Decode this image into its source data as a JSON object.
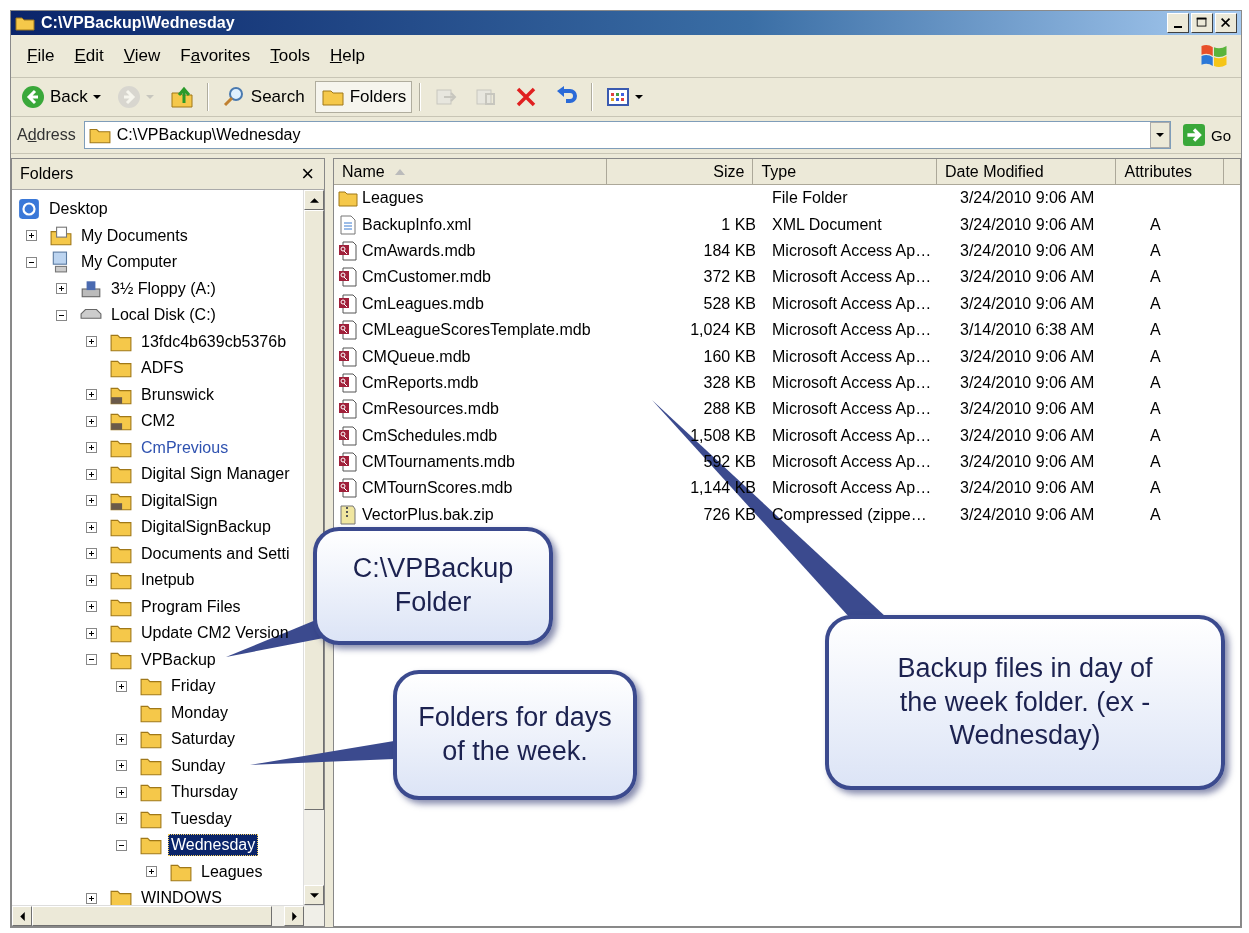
{
  "window": {
    "title": "C:\\VPBackup\\Wednesday"
  },
  "menu": [
    {
      "label": "File"
    },
    {
      "label": "Edit"
    },
    {
      "label": "View"
    },
    {
      "label": "Favorites"
    },
    {
      "label": "Tools"
    },
    {
      "label": "Help"
    }
  ],
  "toolbar": [
    {
      "kind": "back",
      "label": "Back",
      "disabled": false,
      "pressed": false,
      "dropdown": true
    },
    {
      "kind": "forward",
      "disabled": true,
      "pressed": false,
      "dropdown": true
    },
    {
      "kind": "up",
      "disabled": false,
      "pressed": false,
      "dropdown": false
    },
    {
      "kind": "separator"
    },
    {
      "kind": "search",
      "label": "Search",
      "disabled": false,
      "pressed": false,
      "dropdown": false
    },
    {
      "kind": "folders",
      "label": "Folders",
      "disabled": false,
      "pressed": true,
      "dropdown": false
    },
    {
      "kind": "separator"
    },
    {
      "kind": "move",
      "disabled": true,
      "pressed": false,
      "dropdown": false
    },
    {
      "kind": "copy",
      "disabled": true,
      "pressed": false,
      "dropdown": false
    },
    {
      "kind": "delete",
      "disabled": false,
      "pressed": false,
      "dropdown": false
    },
    {
      "kind": "undo",
      "disabled": false,
      "pressed": false,
      "dropdown": false
    },
    {
      "kind": "separator"
    },
    {
      "kind": "views",
      "disabled": false,
      "pressed": false,
      "dropdown": true
    }
  ],
  "address": {
    "label": "Address",
    "value": "C:\\VPBackup\\Wednesday",
    "go": "Go"
  },
  "folders_pane": {
    "title": "Folders",
    "close": "×"
  },
  "tree": [
    {
      "label": "Desktop",
      "kind": "desktop",
      "selected": false,
      "compressed": false,
      "children": [
        {
          "label": "My Documents",
          "kind": "documents",
          "expandable": true,
          "expanded": false,
          "selected": false,
          "compressed": false
        },
        {
          "label": "My Computer",
          "kind": "computer",
          "expandable": true,
          "expanded": true,
          "selected": false,
          "compressed": false,
          "children": [
            {
              "label": "3½ Floppy (A:)",
              "kind": "floppy",
              "expandable": true,
              "expanded": false,
              "selected": false,
              "compressed": false
            },
            {
              "label": "Local Disk (C:)",
              "kind": "drive",
              "expandable": true,
              "expanded": true,
              "selected": false,
              "compressed": false,
              "children": [
                {
                  "label": "13fdc4b639cb5376b",
                  "kind": "folder",
                  "expandable": true,
                  "expanded": false,
                  "selected": false,
                  "compressed": false
                },
                {
                  "label": "ADFS",
                  "kind": "folder",
                  "expandable": false,
                  "expanded": false,
                  "selected": false,
                  "compressed": false
                },
                {
                  "label": "Brunswick",
                  "kind": "shared-folder",
                  "expandable": true,
                  "expanded": false,
                  "selected": false,
                  "compressed": false
                },
                {
                  "label": "CM2",
                  "kind": "shared-folder",
                  "expandable": true,
                  "expanded": false,
                  "selected": false,
                  "compressed": false
                },
                {
                  "label": "CmPrevious",
                  "kind": "folder",
                  "expandable": true,
                  "expanded": false,
                  "selected": false,
                  "compressed": true
                },
                {
                  "label": "Digital Sign Manager",
                  "kind": "folder",
                  "expandable": true,
                  "expanded": false,
                  "selected": false,
                  "compressed": false
                },
                {
                  "label": "DigitalSign",
                  "kind": "shared-folder",
                  "expandable": true,
                  "expanded": false,
                  "selected": false,
                  "compressed": false
                },
                {
                  "label": "DigitalSignBackup",
                  "kind": "folder",
                  "expandable": true,
                  "expanded": false,
                  "selected": false,
                  "compressed": false
                },
                {
                  "label": "Documents and Setti",
                  "kind": "folder",
                  "expandable": true,
                  "expanded": false,
                  "selected": false,
                  "compressed": false
                },
                {
                  "label": "Inetpub",
                  "kind": "folder",
                  "expandable": true,
                  "expanded": false,
                  "selected": false,
                  "compressed": false
                },
                {
                  "label": "Program Files",
                  "kind": "folder",
                  "expandable": true,
                  "expanded": false,
                  "selected": false,
                  "compressed": false
                },
                {
                  "label": "Update CM2 Version",
                  "kind": "folder",
                  "expandable": true,
                  "expanded": false,
                  "selected": false,
                  "compressed": false
                },
                {
                  "label": "VPBackup",
                  "kind": "folder",
                  "expandable": true,
                  "expanded": true,
                  "selected": false,
                  "compressed": false,
                  "children": [
                    {
                      "label": "Friday",
                      "kind": "folder",
                      "expandable": true,
                      "expanded": false,
                      "selected": false,
                      "compressed": false
                    },
                    {
                      "label": "Monday",
                      "kind": "folder",
                      "expandable": false,
                      "expanded": false,
                      "selected": false,
                      "compressed": false
                    },
                    {
                      "label": "Saturday",
                      "kind": "folder",
                      "expandable": true,
                      "expanded": false,
                      "selected": false,
                      "compressed": false
                    },
                    {
                      "label": "Sunday",
                      "kind": "folder",
                      "expandable": true,
                      "expanded": false,
                      "selected": false,
                      "compressed": false
                    },
                    {
                      "label": "Thursday",
                      "kind": "folder",
                      "expandable": true,
                      "expanded": false,
                      "selected": false,
                      "compressed": false
                    },
                    {
                      "label": "Tuesday",
                      "kind": "folder",
                      "expandable": true,
                      "expanded": false,
                      "selected": false,
                      "compressed": false
                    },
                    {
                      "label": "Wednesday",
                      "kind": "folder",
                      "expandable": true,
                      "expanded": true,
                      "selected": true,
                      "compressed": false,
                      "children": [
                        {
                          "label": "Leagues",
                          "kind": "folder",
                          "expandable": true,
                          "expanded": false,
                          "selected": false,
                          "compressed": false
                        }
                      ]
                    }
                  ]
                },
                {
                  "label": "WINDOWS",
                  "kind": "folder",
                  "expandable": true,
                  "expanded": false,
                  "selected": false,
                  "compressed": false
                }
              ]
            }
          ]
        }
      ]
    }
  ],
  "table": {
    "columns": [
      {
        "label": "Name",
        "sorted": true
      },
      {
        "label": "Size",
        "sorted": false
      },
      {
        "label": "Type",
        "sorted": false
      },
      {
        "label": "Date Modified",
        "sorted": false
      },
      {
        "label": "Attributes",
        "sorted": false
      }
    ],
    "rows": [
      {
        "kind": "folder",
        "name": "Leagues",
        "size": "",
        "type": "File Folder",
        "date": "3/24/2010 9:06 AM",
        "attributes": ""
      },
      {
        "kind": "xml",
        "name": "BackupInfo.xml",
        "size": "1 KB",
        "type": "XML Document",
        "date": "3/24/2010 9:06 AM",
        "attributes": "A"
      },
      {
        "kind": "mdb",
        "name": "CmAwards.mdb",
        "size": "184 KB",
        "type": "Microsoft Access Ap…",
        "date": "3/24/2010 9:06 AM",
        "attributes": "A"
      },
      {
        "kind": "mdb",
        "name": "CmCustomer.mdb",
        "size": "372 KB",
        "type": "Microsoft Access Ap…",
        "date": "3/24/2010 9:06 AM",
        "attributes": "A"
      },
      {
        "kind": "mdb",
        "name": "CmLeagues.mdb",
        "size": "528 KB",
        "type": "Microsoft Access Ap…",
        "date": "3/24/2010 9:06 AM",
        "attributes": "A"
      },
      {
        "kind": "mdb",
        "name": "CMLeagueScoresTemplate.mdb",
        "size": "1,024 KB",
        "type": "Microsoft Access Ap…",
        "date": "3/14/2010 6:38 AM",
        "attributes": "A"
      },
      {
        "kind": "mdb",
        "name": "CMQueue.mdb",
        "size": "160 KB",
        "type": "Microsoft Access Ap…",
        "date": "3/24/2010 9:06 AM",
        "attributes": "A"
      },
      {
        "kind": "mdb",
        "name": "CmReports.mdb",
        "size": "328 KB",
        "type": "Microsoft Access Ap…",
        "date": "3/24/2010 9:06 AM",
        "attributes": "A"
      },
      {
        "kind": "mdb",
        "name": "CmResources.mdb",
        "size": "288 KB",
        "type": "Microsoft Access Ap…",
        "date": "3/24/2010 9:06 AM",
        "attributes": "A"
      },
      {
        "kind": "mdb",
        "name": "CmSchedules.mdb",
        "size": "1,508 KB",
        "type": "Microsoft Access Ap…",
        "date": "3/24/2010 9:06 AM",
        "attributes": "A"
      },
      {
        "kind": "mdb",
        "name": "CMTournaments.mdb",
        "size": "592 KB",
        "type": "Microsoft Access Ap…",
        "date": "3/24/2010 9:06 AM",
        "attributes": "A"
      },
      {
        "kind": "mdb",
        "name": "CMTournScores.mdb",
        "size": "1,144 KB",
        "type": "Microsoft Access Ap…",
        "date": "3/24/2010 9:06 AM",
        "attributes": "A"
      },
      {
        "kind": "zip",
        "name": "VectorPlus.bak.zip",
        "size": "726 KB",
        "type": "Compressed (zippe…",
        "date": "3/24/2010 9:06 AM",
        "attributes": "A"
      }
    ]
  },
  "callouts": [
    {
      "text": "C:\\VPBackup Folder"
    },
    {
      "text": "Folders for days of the week."
    },
    {
      "text": "Backup files in day of the week folder. (ex - Wednesday)"
    }
  ]
}
